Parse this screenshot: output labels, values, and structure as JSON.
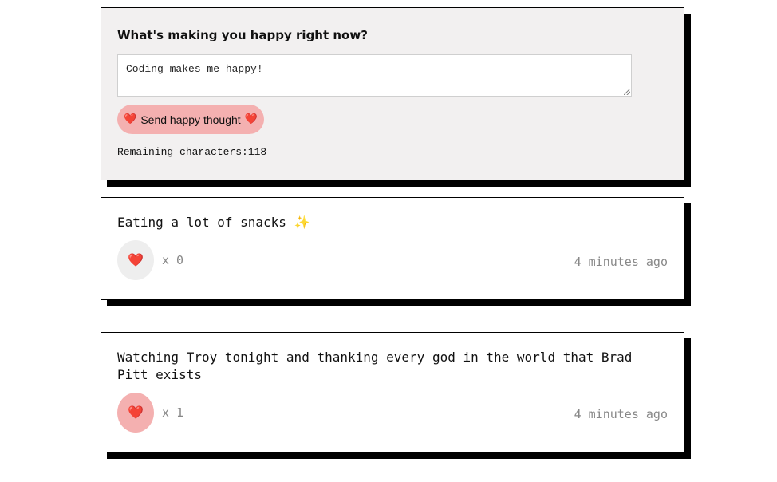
{
  "form": {
    "title": "What's making you happy right now?",
    "input_value": "Coding makes me happy!",
    "send_label": "Send happy thought",
    "heart_glyph": "❤️",
    "remaining_label": "Remaining characters:",
    "remaining_count": "118"
  },
  "thoughts": [
    {
      "text": "Eating a lot of snacks",
      "emoji": "✨",
      "like_count": "x 0",
      "liked": false,
      "time": "4 minutes ago"
    },
    {
      "text": "Watching Troy tonight and thanking every god in the world that Brad Pitt exists",
      "emoji": "",
      "like_count": "x 1",
      "liked": true,
      "time": "4 minutes ago"
    }
  ],
  "colors": {
    "button_pink": "#f4b0b0",
    "form_background": "#f2f0f0",
    "unliked_circle": "#eeeeee",
    "heart_red": "#e0202a",
    "muted_text": "#888888"
  }
}
